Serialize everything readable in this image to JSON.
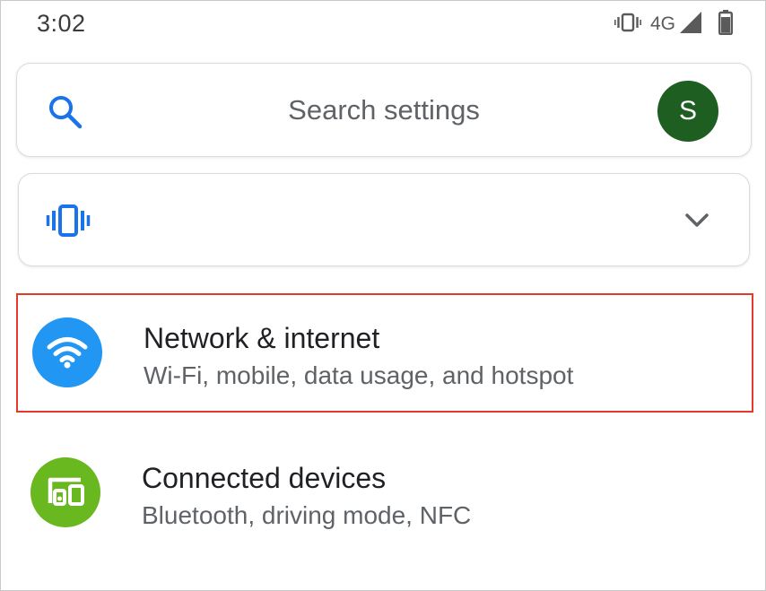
{
  "status_bar": {
    "time": "3:02",
    "network": "4G",
    "icons": [
      "vibrate-icon",
      "signal-icon",
      "battery-icon"
    ]
  },
  "search": {
    "placeholder": "Search settings",
    "avatar_letter": "S",
    "avatar_color": "#1e5e20"
  },
  "sound_card": {
    "icons": [
      "vibrate-icon",
      "chevron-down-icon"
    ]
  },
  "settings": [
    {
      "title": "Network & internet",
      "subtitle": "Wi-Fi, mobile, data usage, and hotspot",
      "icon": "wifi-icon",
      "icon_color": "#2196f3",
      "highlighted": true
    },
    {
      "title": "Connected devices",
      "subtitle": "Bluetooth, driving mode, NFC",
      "icon": "connected-devices-icon",
      "icon_color": "#6ab820",
      "highlighted": false
    }
  ],
  "colors": {
    "accent_blue": "#1a73e8",
    "highlight_border": "#e53a2a"
  }
}
